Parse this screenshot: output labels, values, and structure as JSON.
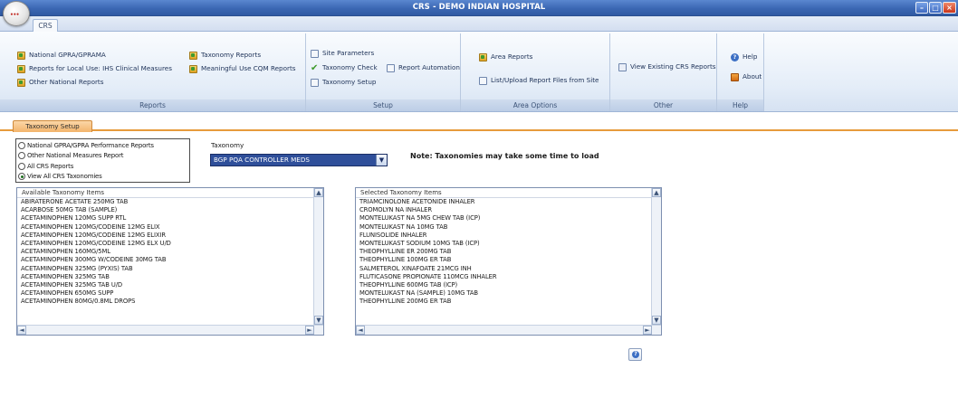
{
  "window": {
    "title": "CRS - DEMO INDIAN HOSPITAL",
    "app_logo_text": "•••",
    "controls": {
      "minimize": "–",
      "maximize": "□",
      "close": "×"
    }
  },
  "ribbon_tabs": [
    {
      "label": "CRS"
    }
  ],
  "ribbon": {
    "reports": {
      "label": "Reports",
      "col1": [
        "National GPRA/GPRAMA",
        "Reports for Local Use: IHS Clinical Measures",
        "Other National Reports"
      ],
      "col2": [
        "Taxonomy Reports",
        "Meaningful Use CQM Reports"
      ]
    },
    "setup": {
      "label": "Setup",
      "col1": [
        "Site Parameters",
        "Taxonomy Check",
        "Taxonomy Setup"
      ],
      "col2": [
        "Report Automation"
      ]
    },
    "area_options": {
      "label": "Area Options",
      "items": [
        "Area Reports",
        "List/Upload Report Files from Site"
      ]
    },
    "other": {
      "label": "Other",
      "items": [
        "View Existing CRS Reports"
      ]
    },
    "help": {
      "label": "Help",
      "items": [
        "Help",
        "About"
      ]
    }
  },
  "content_tabs": [
    {
      "label": "Taxonomy Setup"
    }
  ],
  "report_type_options": [
    {
      "label": "National GPRA/GPRA Performance Reports",
      "selected": false
    },
    {
      "label": "Other National Measures Report",
      "selected": false
    },
    {
      "label": "All CRS Reports",
      "selected": false
    },
    {
      "label": "View All CRS Taxonomies",
      "selected": true
    }
  ],
  "taxonomy": {
    "label": "Taxonomy",
    "selected": "BGP PQA CONTROLLER MEDS"
  },
  "note": "Note:  Taxonomies may take some time to load",
  "available_list": {
    "header": "Available Taxonomy Items",
    "items": [
      "ABIRATERONE ACETATE 250MG TAB",
      "ACARBOSE 50MG TAB (SAMPLE)",
      "ACETAMINOPHEN 120MG SUPP RTL",
      "ACETAMINOPHEN 120MG/CODEINE 12MG ELIX",
      "ACETAMINOPHEN 120MG/CODEINE 12MG ELIXIR",
      "ACETAMINOPHEN 120MG/CODEINE 12MG ELX U/D",
      "ACETAMINOPHEN 160MG/5ML",
      "ACETAMINOPHEN 300MG W/CODEINE 30MG TAB",
      "ACETAMINOPHEN 325MG (PYXIS) TAB",
      "ACETAMINOPHEN 325MG TAB",
      "ACETAMINOPHEN 325MG TAB U/D",
      "ACETAMINOPHEN 650MG SUPP",
      "ACETAMINOPHEN 80MG/0.8ML DROPS"
    ]
  },
  "selected_list": {
    "header": "Selected Taxonomy Items",
    "items": [
      "TRIAMCINOLONE ACETONIDE INHALER",
      "CROMOLYN NA INHALER",
      "MONTELUKAST NA 5MG CHEW TAB (ICP)",
      "MONTELUKAST NA 10MG TAB",
      "FLUNISOLIDE INHALER",
      "MONTELUKAST SODIUM 10MG TAB (ICP)",
      "THEOPHYLLINE ER 200MG TAB",
      "THEOPHYLLINE 100MG ER TAB",
      "SALMETEROL XINAFOATE 21MCG INH",
      "FLUTICASONE PROPIONATE 110MCG INHALER",
      "THEOPHYLLINE 600MG TAB (ICP)",
      "MONTELUKAST NA (SAMPLE) 10MG TAB",
      "THEOPHYLLINE 200MG ER TAB"
    ]
  },
  "scroll_glyphs": {
    "up": "▲",
    "down": "▼",
    "left": "◄",
    "right": "►"
  },
  "help_button_glyph": "?",
  "colors": {
    "title_bar": "#3b67b3",
    "tab_accent": "#f3b46c",
    "dropdown_selected": "#2f4f9a"
  }
}
